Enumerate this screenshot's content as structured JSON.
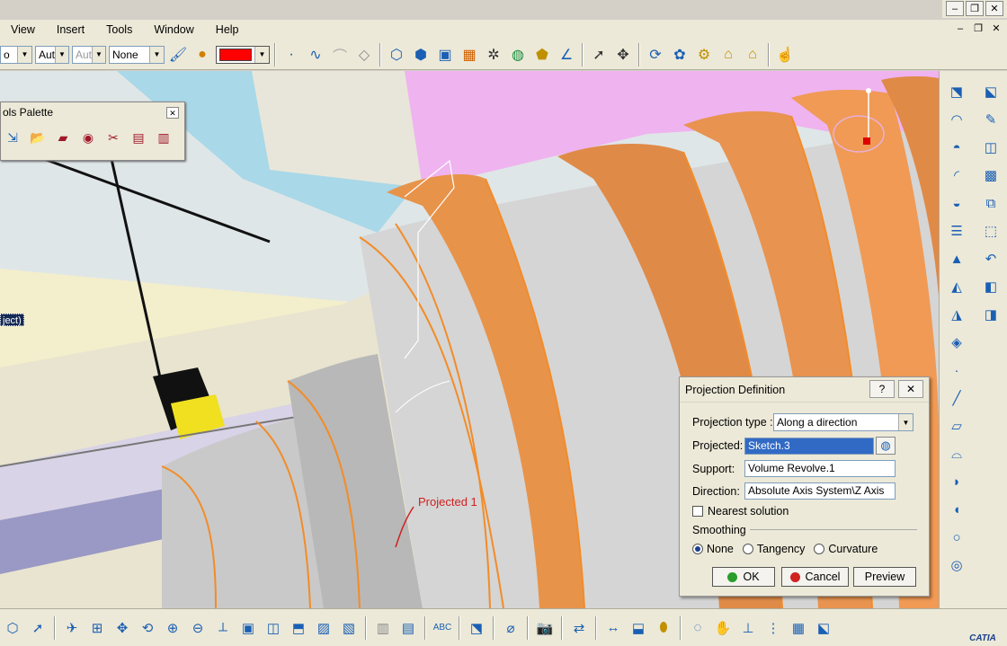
{
  "window_controls": {
    "minimize": "–",
    "restore": "❐",
    "close": "✕"
  },
  "menu": [
    "View",
    "Insert",
    "Tools",
    "Window",
    "Help"
  ],
  "toolbar": {
    "combo1": "o",
    "combo2": "Aut",
    "combo3": "Aut",
    "combo4": "None",
    "color": "#ff0000"
  },
  "palette": {
    "title": "ols Palette",
    "close": "✕"
  },
  "tree_label": "ject)",
  "viewport": {
    "annotation": "Projected 1"
  },
  "dialog": {
    "title": "Projection Definition",
    "help": "?",
    "close": "✕",
    "projection_type_label": "Projection type :",
    "projection_type_value": "Along a direction",
    "projected_label": "Projected:",
    "projected_value": "Sketch.3",
    "support_label": "Support:",
    "support_value": "Volume Revolve.1",
    "direction_label": "Direction:",
    "direction_value": "Absolute Axis System\\Z Axis",
    "nearest_label": "Nearest solution",
    "smoothing_label": "Smoothing",
    "smoothing_options": [
      "None",
      "Tangency",
      "Curvature"
    ],
    "smoothing_selected": "None",
    "ok": "OK",
    "cancel": "Cancel",
    "preview": "Preview"
  },
  "logo": "CATIA"
}
